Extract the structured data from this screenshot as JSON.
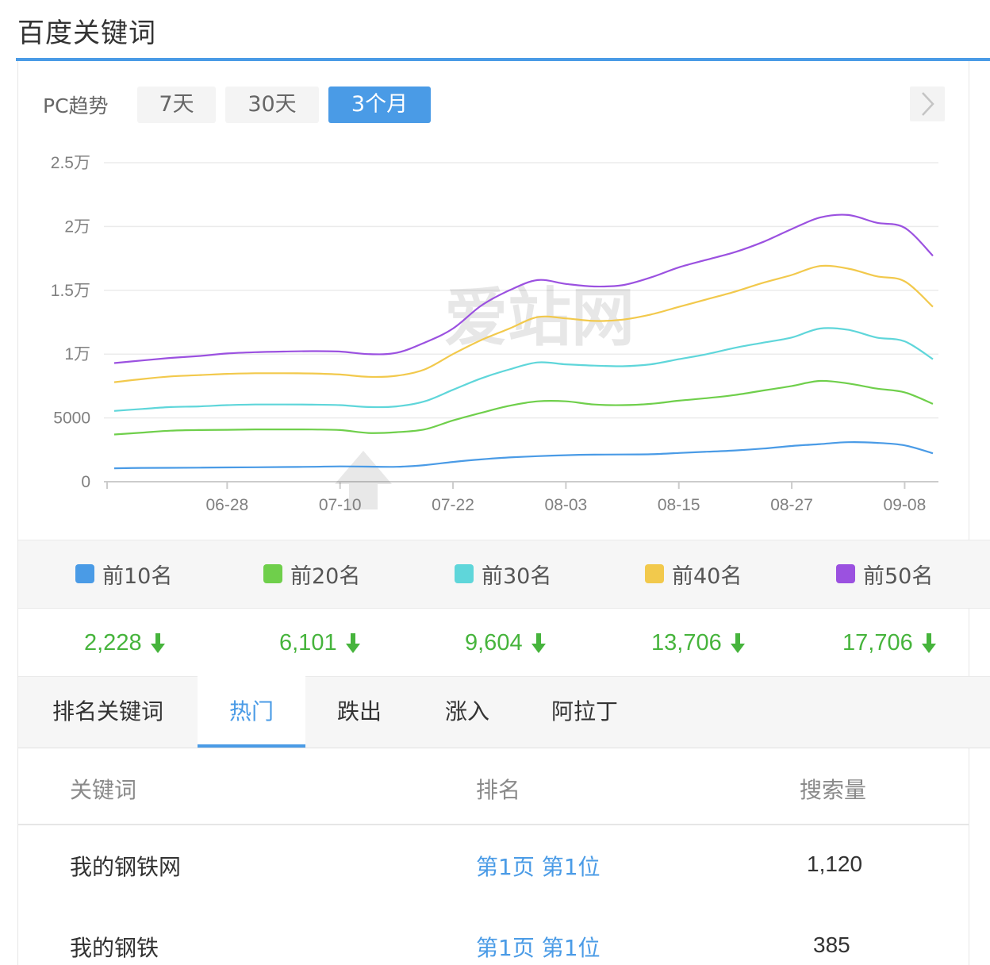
{
  "header": {
    "title": "百度关键词"
  },
  "trend": {
    "label": "PC趋势",
    "ranges": [
      "7天",
      "30天",
      "3个月"
    ],
    "active_range": "3个月",
    "next_icon": "chevron-right-icon"
  },
  "watermark": "爱站网",
  "colors": {
    "accent": "#4a9be6",
    "down": "#46b43c",
    "top10": "#4a9be6",
    "top20": "#6fcf4b",
    "top30": "#5fd6da",
    "top40": "#f2c94c",
    "top50": "#9b51e0"
  },
  "chart_data": {
    "type": "line",
    "title": "",
    "xlabel": "",
    "ylabel": "",
    "x_tick_labels": [
      "06-28",
      "07-10",
      "07-22",
      "08-03",
      "08-15",
      "08-27",
      "09-08"
    ],
    "y_tick_labels": [
      "0",
      "5000",
      "1万",
      "1.5万",
      "2万",
      "2.5万"
    ],
    "ylim": [
      0,
      25000
    ],
    "grid": true,
    "x_dates": [
      "06-16",
      "06-19",
      "06-22",
      "06-25",
      "06-28",
      "07-01",
      "07-04",
      "07-07",
      "07-10",
      "07-13",
      "07-16",
      "07-19",
      "07-22",
      "07-25",
      "07-28",
      "07-31",
      "08-03",
      "08-06",
      "08-09",
      "08-12",
      "08-15",
      "08-18",
      "08-21",
      "08-24",
      "08-27",
      "08-30",
      "09-02",
      "09-05",
      "09-08",
      "09-11"
    ],
    "series": [
      {
        "name": "前10名",
        "color": "#4a9be6",
        "values": [
          1050,
          1080,
          1090,
          1100,
          1120,
          1130,
          1150,
          1170,
          1200,
          1180,
          1170,
          1300,
          1550,
          1750,
          1900,
          2000,
          2080,
          2120,
          2130,
          2150,
          2250,
          2350,
          2450,
          2600,
          2800,
          2950,
          3100,
          3050,
          2850,
          2228
        ]
      },
      {
        "name": "前20名",
        "color": "#6fcf4b",
        "values": [
          3700,
          3850,
          4000,
          4050,
          4070,
          4100,
          4100,
          4090,
          4050,
          3820,
          3880,
          4100,
          4800,
          5400,
          5950,
          6300,
          6300,
          6050,
          6000,
          6100,
          6350,
          6550,
          6800,
          7150,
          7500,
          7900,
          7700,
          7300,
          7000,
          6101
        ]
      },
      {
        "name": "前30名",
        "color": "#5fd6da",
        "values": [
          5550,
          5700,
          5850,
          5900,
          6000,
          6050,
          6050,
          6040,
          6000,
          5850,
          5900,
          6300,
          7200,
          8100,
          8800,
          9350,
          9200,
          9100,
          9050,
          9200,
          9600,
          10000,
          10500,
          10900,
          11300,
          12000,
          11900,
          11300,
          11000,
          9604
        ]
      },
      {
        "name": "前40名",
        "color": "#f2c94c",
        "values": [
          7800,
          8050,
          8250,
          8350,
          8450,
          8500,
          8500,
          8480,
          8400,
          8220,
          8300,
          8800,
          10000,
          11100,
          12000,
          12900,
          12800,
          12600,
          12700,
          13100,
          13700,
          14300,
          14900,
          15600,
          16200,
          16900,
          16700,
          16100,
          15700,
          13706
        ]
      },
      {
        "name": "前50名",
        "color": "#9b51e0",
        "values": [
          9300,
          9500,
          9700,
          9850,
          10050,
          10150,
          10200,
          10230,
          10200,
          10000,
          10100,
          10900,
          12000,
          13800,
          15000,
          15800,
          15500,
          15300,
          15400,
          16000,
          16800,
          17400,
          18000,
          18800,
          19800,
          20700,
          20900,
          20300,
          19900,
          17706
        ]
      }
    ]
  },
  "legend": [
    {
      "label": "前10名",
      "color": "#4a9be6"
    },
    {
      "label": "前20名",
      "color": "#6fcf4b"
    },
    {
      "label": "前30名",
      "color": "#5fd6da"
    },
    {
      "label": "前40名",
      "color": "#f2c94c"
    },
    {
      "label": "前50名",
      "color": "#9b51e0"
    }
  ],
  "values": [
    "2,228",
    "6,101",
    "9,604",
    "13,706",
    "17,706"
  ],
  "value_icon": "arrow-down-icon",
  "tabs": {
    "title": "排名关键词",
    "items": [
      "热门",
      "跌出",
      "涨入",
      "阿拉丁"
    ],
    "active": "热门"
  },
  "table": {
    "headers": [
      "关键词",
      "排名",
      "搜索量"
    ],
    "rows": [
      {
        "keyword": "我的钢铁网",
        "rank": "第1页 第1位",
        "volume": "1,120"
      },
      {
        "keyword": "我的钢铁",
        "rank": "第1页 第1位",
        "volume": "385"
      }
    ]
  }
}
